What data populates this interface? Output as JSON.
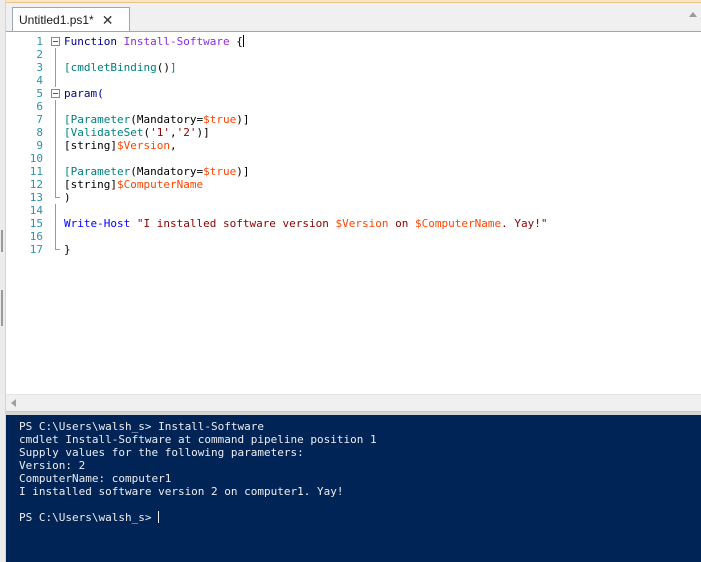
{
  "tab": {
    "title": "Untitled1.ps1*",
    "close_glyph": "✕"
  },
  "editor": {
    "line_numbers": [
      "1",
      "2",
      "3",
      "4",
      "5",
      "6",
      "7",
      "8",
      "9",
      "10",
      "11",
      "12",
      "13",
      "14",
      "15",
      "16",
      "17"
    ],
    "lines": [
      [
        {
          "t": "Function ",
          "c": "kw"
        },
        {
          "t": "Install-Software",
          "c": "fn"
        },
        {
          "t": " {",
          "c": "gr"
        }
      ],
      [],
      [
        {
          "t": "[cmdletBinding",
          "c": "ty"
        },
        {
          "t": "()",
          "c": "gr"
        },
        {
          "t": "]",
          "c": "ty"
        }
      ],
      [],
      [
        {
          "t": "param(",
          "c": "kw"
        }
      ],
      [],
      [
        {
          "t": "[Parameter",
          "c": "ty"
        },
        {
          "t": "(Mandatory=",
          "c": "gr"
        },
        {
          "t": "$true",
          "c": "va"
        },
        {
          "t": ")]",
          "c": "gr"
        }
      ],
      [
        {
          "t": "[ValidateSet",
          "c": "ty"
        },
        {
          "t": "(",
          "c": "gr"
        },
        {
          "t": "'1'",
          "c": "st"
        },
        {
          "t": ",",
          "c": "gr"
        },
        {
          "t": "'2'",
          "c": "st"
        },
        {
          "t": ")]",
          "c": "gr"
        }
      ],
      [
        {
          "t": "[string]",
          "c": "gr"
        },
        {
          "t": "$Version",
          "c": "va"
        },
        {
          "t": ",",
          "c": "gr"
        }
      ],
      [],
      [
        {
          "t": "[Parameter",
          "c": "ty"
        },
        {
          "t": "(Mandatory=",
          "c": "gr"
        },
        {
          "t": "$true",
          "c": "va"
        },
        {
          "t": ")]",
          "c": "gr"
        }
      ],
      [
        {
          "t": "[string]",
          "c": "gr"
        },
        {
          "t": "$ComputerName",
          "c": "va"
        }
      ],
      [
        {
          "t": ")",
          "c": "gr"
        }
      ],
      [],
      [
        {
          "t": "Write-Host ",
          "c": "cmd"
        },
        {
          "t": "\"I installed software version ",
          "c": "st"
        },
        {
          "t": "$Version",
          "c": "va"
        },
        {
          "t": " on ",
          "c": "st"
        },
        {
          "t": "$ComputerName",
          "c": "va"
        },
        {
          "t": ". Yay!\"",
          "c": "st"
        }
      ],
      [],
      [
        {
          "t": "}",
          "c": "gr"
        }
      ]
    ]
  },
  "console": {
    "lines": [
      "PS C:\\Users\\walsh_s> Install-Software",
      "cmdlet Install-Software at command pipeline position 1",
      "Supply values for the following parameters:",
      "Version: 2",
      "ComputerName: computer1",
      "I installed software version 2 on computer1. Yay!",
      "",
      "PS C:\\Users\\walsh_s> "
    ]
  },
  "colors": {
    "console_bg": "#012456",
    "console_fg": "#eeedf0",
    "editor_bg": "#ffffff",
    "line_number": "#2b91af",
    "keyword": "#00008b",
    "function_name": "#8a2be2",
    "type": "#008080",
    "variable": "#ff4500",
    "string": "#8b0000",
    "command": "#0000ff"
  }
}
